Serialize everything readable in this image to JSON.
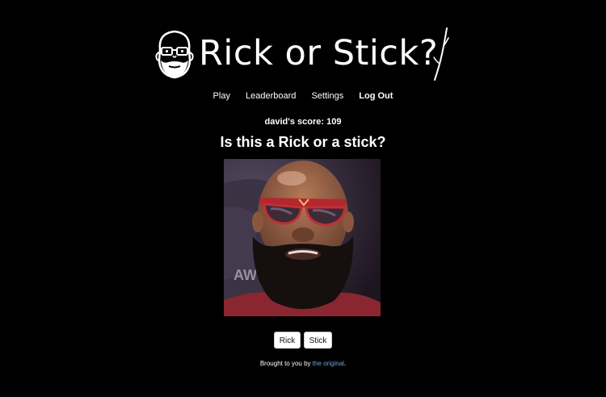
{
  "header": {
    "title": "Rick or Stick?"
  },
  "nav": {
    "items": [
      {
        "label": "Play"
      },
      {
        "label": "Leaderboard"
      },
      {
        "label": "Settings"
      },
      {
        "label": "Log Out"
      }
    ]
  },
  "score": {
    "text": "david's score: 109"
  },
  "question": {
    "text": "Is this a Rick or a stick?"
  },
  "photo": {
    "icon": "person-photo"
  },
  "actions": {
    "rick_label": "Rick",
    "stick_label": "Stick"
  },
  "footer": {
    "prefix": "Brought to you by ",
    "link_text": "the original",
    "suffix": "."
  },
  "colors": {
    "background": "#000000",
    "text": "#ffffff",
    "link": "#6ea6e0"
  }
}
